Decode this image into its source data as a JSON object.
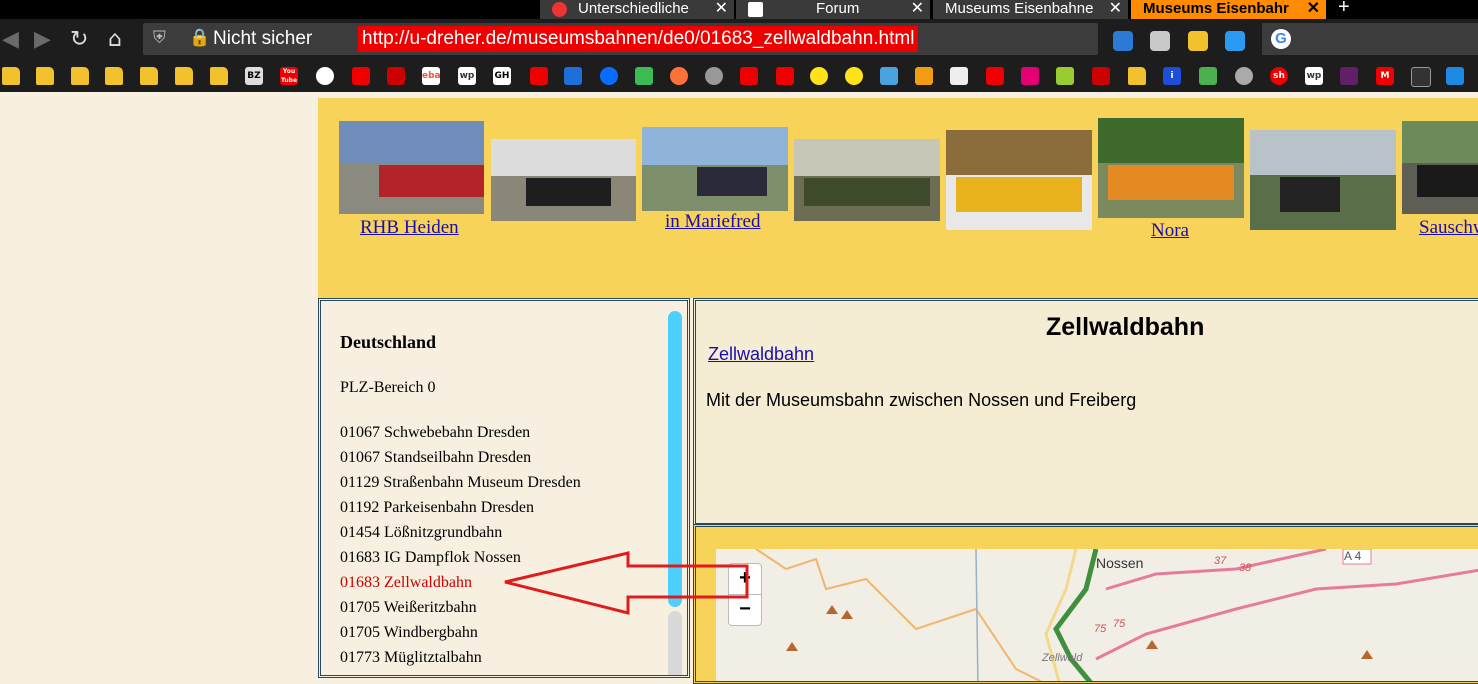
{
  "tabs": [
    {
      "title": "Unterschiedliche",
      "active": false,
      "close": "✕"
    },
    {
      "title": "Forum",
      "active": false,
      "close": "✕"
    },
    {
      "title": "Museums Eisenbahne",
      "active": false,
      "close": "✕"
    },
    {
      "title": "Museums Eisenbahr",
      "active": true,
      "close": "✕"
    }
  ],
  "new_tab_symbol": "+",
  "navbar": {
    "back_icon": "back-arrow-icon",
    "forward_icon": "forward-arrow-icon",
    "reload_icon": "reload-icon",
    "home_icon": "home-icon",
    "security_label": "Nicht sicher",
    "url": "http://u-dreher.de/museumsbahnen/de0/01683_zellwaldbahn.html"
  },
  "bookmark_labels": [
    "BZ",
    "You Tube",
    "wp",
    "GH",
    "ebay",
    "i",
    "sh",
    "wp",
    "M"
  ],
  "banner": {
    "links": [
      "RHB Heiden",
      "in Mariefred",
      "Nora",
      "Sauschw"
    ]
  },
  "sidebar": {
    "heading": "Deutschland",
    "subheading": "PLZ-Bereich 0",
    "items": [
      {
        "label": "01067 Schwebebahn Dresden",
        "current": false
      },
      {
        "label": "01067 Standseilbahn Dresden",
        "current": false
      },
      {
        "label": "01129 Straßenbahn Museum Dresden",
        "current": false
      },
      {
        "label": "01192 Parkeisenbahn Dresden",
        "current": false
      },
      {
        "label": "01454 Lößnitzgrundbahn",
        "current": false
      },
      {
        "label": "01683 IG Dampflok Nossen",
        "current": false
      },
      {
        "label": "01683 Zellwaldbahn",
        "current": true
      },
      {
        "label": "01705 Weißeritzbahn",
        "current": false
      },
      {
        "label": "01705 Windbergbahn",
        "current": false
      },
      {
        "label": "01773 Müglitztalbahn",
        "current": false
      }
    ]
  },
  "content": {
    "title": "Zellwaldbahn",
    "link": "Zellwaldbahn",
    "description": "Mit der Museumsbahn zwischen Nossen und Freiberg"
  },
  "map": {
    "zoom_in": "+",
    "zoom_out": "−",
    "labels": {
      "town": "Nossen",
      "forest": "Zellwald",
      "road_a4": "A 4",
      "road_37": "37",
      "road_38": "38",
      "road_75a": "75",
      "road_75b": "75"
    }
  },
  "colors": {
    "annotation_arrow": "#e01b1b",
    "banner_bg": "#f8d35a",
    "current_item": "#c00000",
    "active_tab": "#ff8c00"
  }
}
